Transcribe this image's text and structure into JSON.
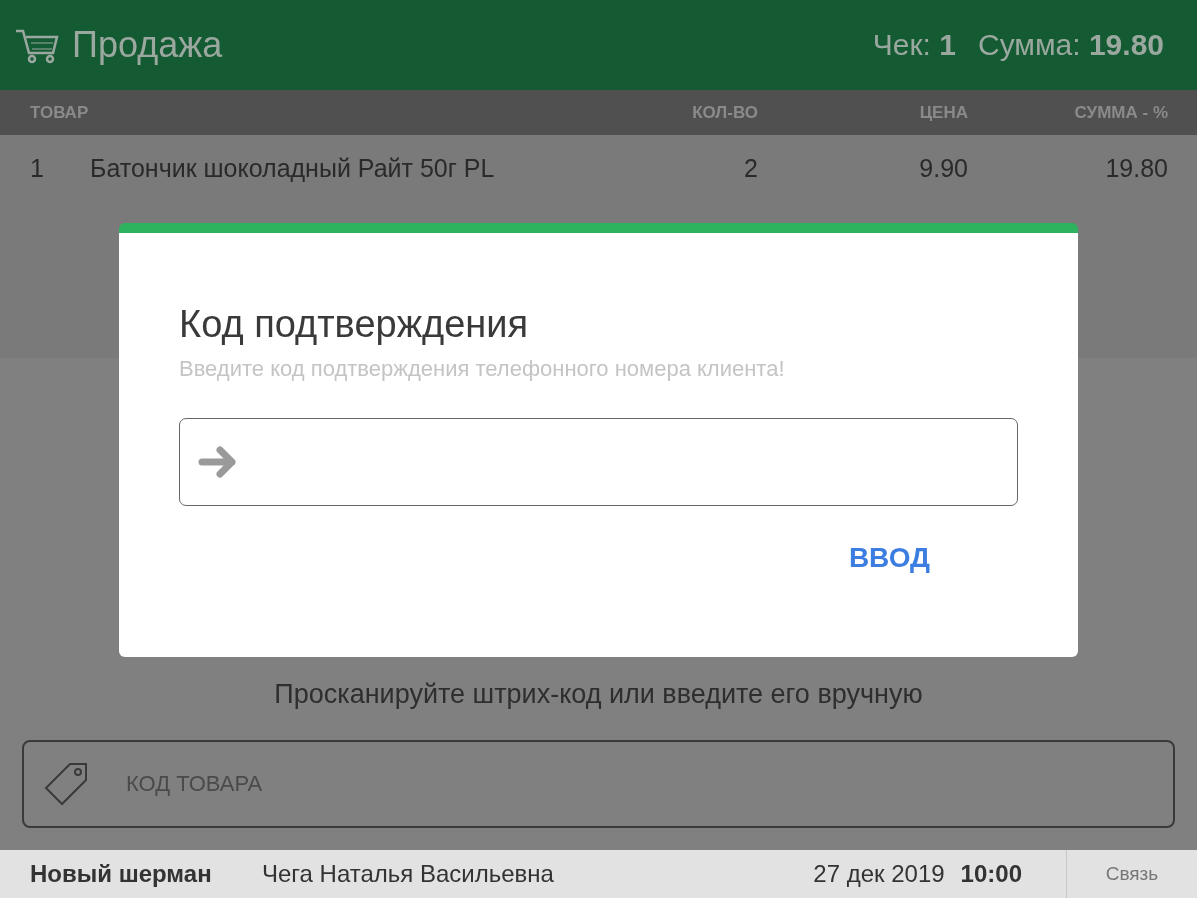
{
  "header": {
    "title": "Продажа",
    "receipt_label": "Чек:",
    "receipt_number": "1",
    "total_label": "Сумма:",
    "total_value": "19.80"
  },
  "table": {
    "columns": [
      "ТОВАР",
      "КОЛ-ВО",
      "ЦЕНА",
      "СУММА - %"
    ],
    "rows": [
      {
        "number": "1",
        "name": "Батончик шоколадный Райт 50г PL",
        "quantity": "2",
        "price": "9.90",
        "sum": "19.80"
      }
    ]
  },
  "scan_prompt": "Просканируйте штрих-код или введите его вручную",
  "product_code": {
    "placeholder": "КОД ТОВАРА"
  },
  "dialog": {
    "title": "Код подтверждения",
    "message": "Введите код подтверждения телефонного номера клиента!",
    "button": "ВВОД"
  },
  "status_bar": {
    "store": "Новый шерман",
    "cashier": "Чега Наталья Васильевна",
    "date": "27 дек 2019",
    "time": "10:00",
    "connection": "Связь"
  }
}
